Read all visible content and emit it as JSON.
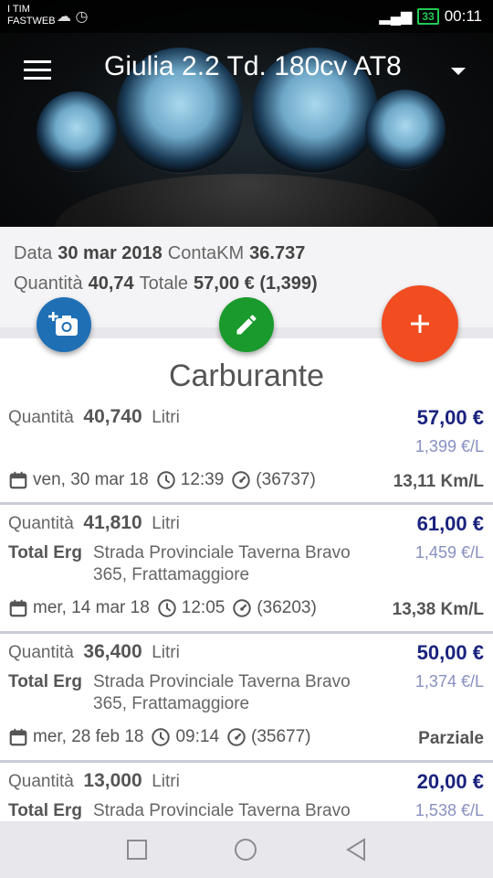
{
  "statusbar": {
    "carrier_line1": "I TIM",
    "carrier_line2": "FASTWEB",
    "battery": "33",
    "time": "00:11"
  },
  "header": {
    "title": "Giulia 2.2 Td. 180cv AT8"
  },
  "summary": {
    "date_label": "Data",
    "date_value": "30 mar 2018",
    "km_label": "ContaKM",
    "km_value": "36.737",
    "qty_label": "Quantità",
    "qty_value": "40,74",
    "total_label": "Totale",
    "total_value": "57,00 € (1,399)"
  },
  "section_title": "Carburante",
  "entries": [
    {
      "qty_label": "Quantità",
      "qty": "40,740",
      "unit": "Litri",
      "price": "57,00 €",
      "price_per_unit": "1,399 €/L",
      "date": "ven, 30 mar 18",
      "time": "12:39",
      "odometer": "(36737)",
      "result": "13,11 Km/L"
    },
    {
      "qty_label": "Quantità",
      "qty": "41,810",
      "unit": "Litri",
      "price": "61,00 €",
      "price_per_unit": "1,459 €/L",
      "station_brand": "Total Erg",
      "station_addr1": "Strada Provinciale Taverna Bravo",
      "station_addr2": "365, Frattamaggiore",
      "date": "mer, 14 mar 18",
      "time": "12:05",
      "odometer": "(36203)",
      "result": "13,38 Km/L"
    },
    {
      "qty_label": "Quantità",
      "qty": "36,400",
      "unit": "Litri",
      "price": "50,00 €",
      "price_per_unit": "1,374 €/L",
      "station_brand": "Total Erg",
      "station_addr1": "Strada Provinciale Taverna Bravo",
      "station_addr2": "365, Frattamaggiore",
      "date": "mer, 28 feb 18",
      "time": "09:14",
      "odometer": "(35677)",
      "result": "Parziale"
    },
    {
      "qty_label": "Quantità",
      "qty": "13,000",
      "unit": "Litri",
      "price": "20,00 €",
      "price_per_unit": "1,538 €/L",
      "station_brand": "Total Erg",
      "station_addr1": "Strada Provinciale Taverna Bravo"
    }
  ],
  "icons": {
    "menu": "menu-icon",
    "dropdown": "caret-down-icon",
    "camera": "add-photo-icon",
    "edit": "pencil-icon",
    "add": "plus-icon",
    "calendar": "calendar-icon",
    "clock": "clock-icon",
    "odometer": "speedometer-icon"
  },
  "colors": {
    "price": "#1a237e",
    "fab_camera": "#1f6fb5",
    "fab_edit": "#1a9a2c",
    "fab_add": "#f24c21"
  }
}
